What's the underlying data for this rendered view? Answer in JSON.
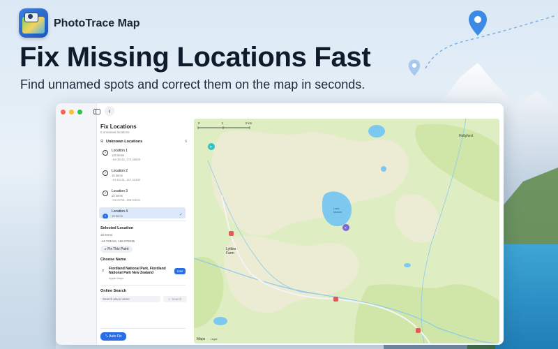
{
  "header": {
    "app_name": "PhotoTrace Map",
    "headline": "Fix Missing Locations Fast",
    "subhead": "Find unnamed spots and correct them on the map in seconds."
  },
  "panel": {
    "title": "Fix Locations",
    "subtitle": "5 unnamed locations",
    "unknown_header": "Unknown Locations",
    "unknown_count": "6",
    "locations": [
      {
        "name": "Location 1",
        "count": "120 items",
        "coords": "-44.00416, 170.46609"
      },
      {
        "name": "Location 2",
        "count": "15 items",
        "coords": "-44.46131, 167.31338"
      },
      {
        "name": "Location 3",
        "count": "20 items",
        "coords": "-44.04791, 168.34044"
      },
      {
        "name": "Location 4",
        "count": "18 items"
      }
    ],
    "selected": {
      "header": "Selected Location",
      "count": "18 items",
      "coords": "-44.783416, 168.076036",
      "fix_button": "Fix This Point"
    },
    "choose_name": {
      "header": "Choose Name",
      "suggestion_title": "Fiordland National Park, Fiordland National Park New Zealand",
      "suggestion_source": "Apple Maps",
      "use_label": "Use"
    },
    "online_search": {
      "header": "Online Search",
      "placeholder": "Search place name",
      "search_label": "Search"
    },
    "auto_fix_label": "Auto Fix"
  },
  "map": {
    "scale_labels": [
      "0",
      "1",
      "2 km"
    ],
    "labels": {
      "hollyford": "Hollyford",
      "lyttles_farm": "Lyttles\nFarm",
      "lake": "Lake\nMarian"
    },
    "attribution": "Maps",
    "legal": "Legal"
  },
  "colors": {
    "accent": "#2a6ee6",
    "map_land": "#dfeec2",
    "map_water": "#7cc8ee"
  }
}
